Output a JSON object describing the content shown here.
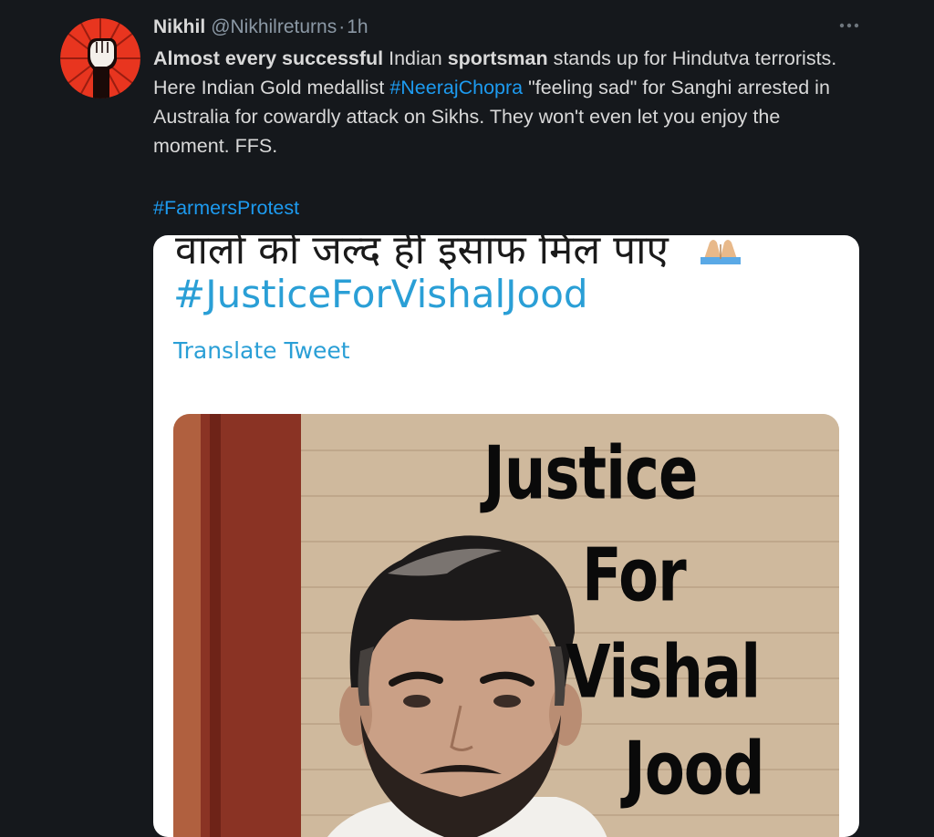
{
  "tweet": {
    "display_name": "Nikhil",
    "handle": "@Nikhilreturns",
    "separator": "·",
    "time": "1h",
    "more_icon": "more-horizontal-icon",
    "avatar_icon": "raised-fist-icon",
    "text_segments": [
      {
        "text": "Almost every successful",
        "style": "bold"
      },
      {
        "text": " Indian ",
        "style": "normal"
      },
      {
        "text": "sportsman",
        "style": "bold"
      },
      {
        "text": " stands up for Hindutva terrorists. Here Indian Gold medallist ",
        "style": "normal"
      },
      {
        "text": "#NeerajChopra",
        "style": "hashtag"
      },
      {
        "text": " \"feeling sad\" for Sanghi arrested in Australia for cowardly attack on Sikhs. They won't even let you enjoy the moment. FFS.",
        "style": "normal"
      }
    ],
    "hashtag_line": "#FarmersProtest"
  },
  "embedded_card": {
    "hindi_fragment": "वालों को जल्द ही इंसाफ मिल पाए",
    "emoji_icon": "folded-hands-emoji",
    "hashtag": "#JusticeForVishalJood",
    "translate_link": "Translate Tweet",
    "poster": {
      "line1": "Justice",
      "line2": "For",
      "line3": "Vishal",
      "line4": "Jood"
    }
  },
  "colors": {
    "background": "#15181c",
    "text": "#d9d9d9",
    "secondary": "#8b98a5",
    "link": "#1d9bf0",
    "avatar_bg": "#e8351f"
  }
}
